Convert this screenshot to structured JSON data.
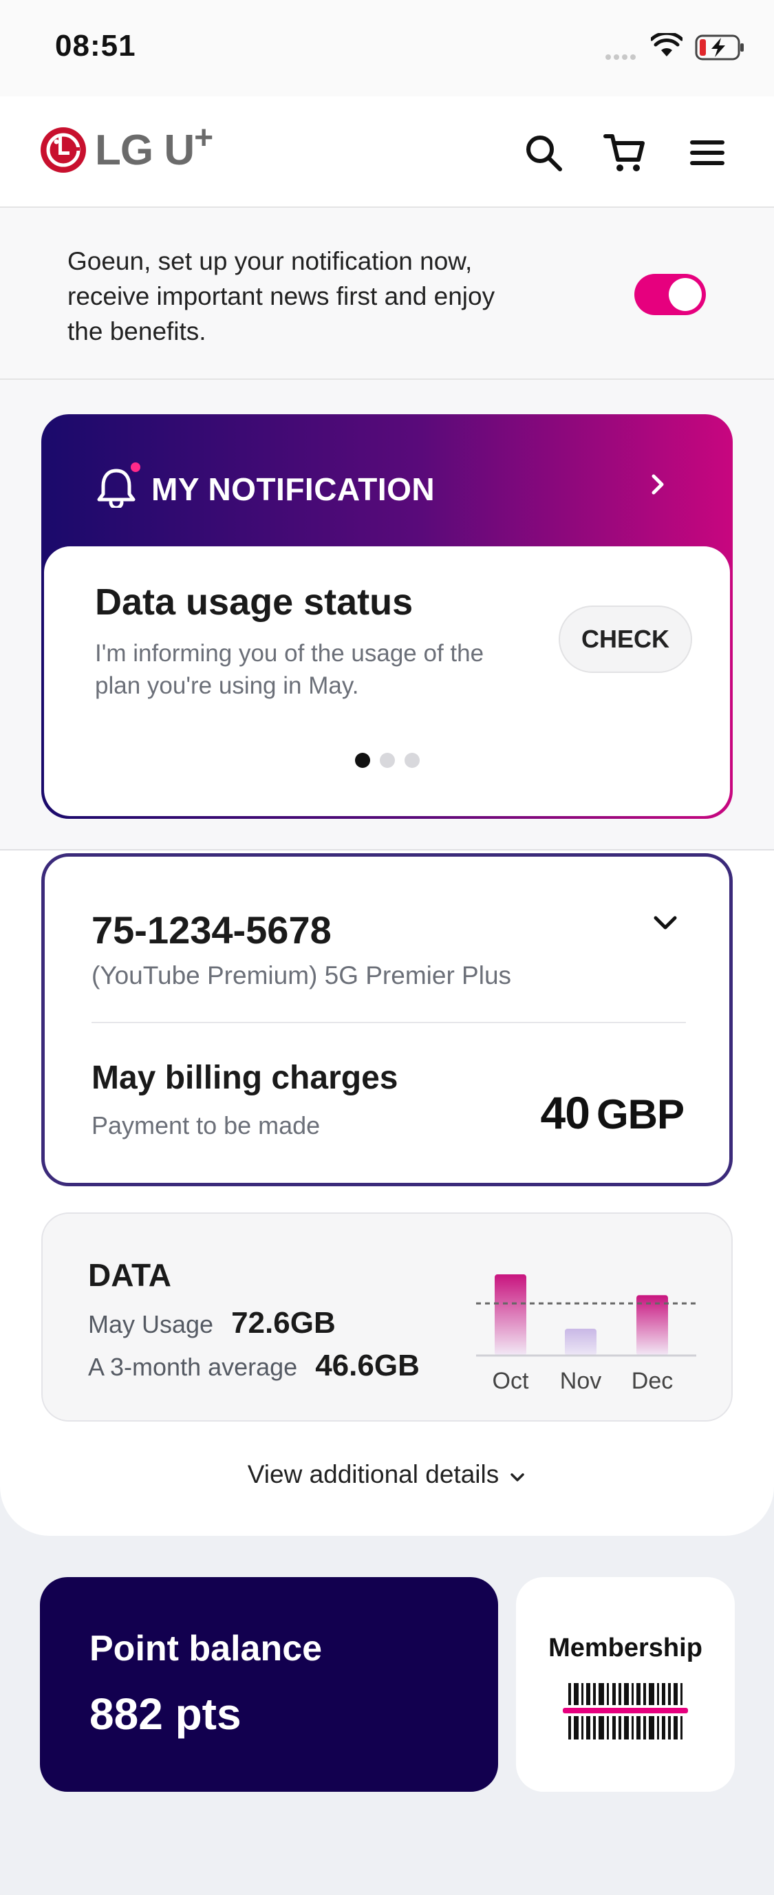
{
  "status_bar": {
    "time": "08:51"
  },
  "header": {
    "brand": "LG U",
    "brand_plus": "+"
  },
  "notification_prompt": {
    "text": "Goeun, set up your notification now, receive important news first and enjoy the benefits.",
    "toggle_on": true
  },
  "my_notification": {
    "title": "MY NOTIFICATION",
    "card_title": "Data usage status",
    "card_desc": "I'm informing you of the usage of the plan you're using in May.",
    "check_label": "CHECK",
    "pages": 3,
    "active_page": 1
  },
  "account": {
    "number": "75-1234-5678",
    "plan": "(YouTube Premium) 5G Premier Plus",
    "billing_title": "May billing charges",
    "billing_sub": "Payment to be made",
    "amount": "40",
    "currency": "GBP"
  },
  "data_usage": {
    "title": "DATA",
    "may_label": "May Usage",
    "may_value": "72.6GB",
    "avg_label": "A 3-month average",
    "avg_value": "46.6GB"
  },
  "chart_data": {
    "type": "bar",
    "categories": [
      "Oct",
      "Nov",
      "Dec"
    ],
    "values": [
      72.6,
      24,
      54
    ],
    "average": 46.6,
    "ylim": [
      0,
      80
    ]
  },
  "details_link": "View additional details",
  "points": {
    "title": "Point balance",
    "value": "882 pts"
  },
  "membership": {
    "title": "Membership"
  },
  "colors": {
    "accent": "#e6007e",
    "navy": "#12004f",
    "card_border": "#3b2a7a"
  }
}
